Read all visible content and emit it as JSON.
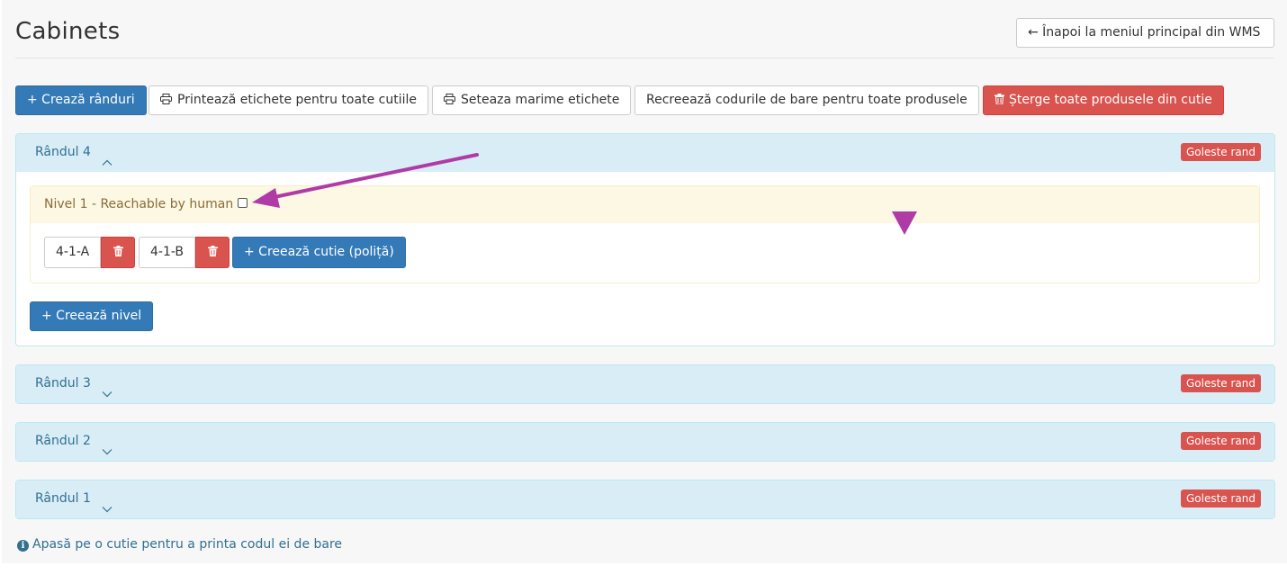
{
  "header": {
    "title": "Cabinets",
    "back_label": "← Înapoi la meniul principal din WMS"
  },
  "toolbar": {
    "create_rows": "+ Crează rânduri",
    "print_labels": "Printează etichete pentru toate cutiile",
    "set_label_size": "Seteaza marime etichete",
    "recreate_barcodes": "Recreează codurile de bare pentru toate produsele",
    "delete_all_products": "Șterge toate produsele din cutie"
  },
  "rows": [
    {
      "title": "Rândul 4",
      "expanded": true,
      "empty_label": "Goleste rand",
      "levels": [
        {
          "title": "Nivel 1 - Reachable by human",
          "boxes": [
            "4-1-A",
            "4-1-B"
          ],
          "create_box_label": "+ Creează cutie (poliță)"
        }
      ],
      "create_level_label": "+ Creează nivel"
    },
    {
      "title": "Rândul 3",
      "expanded": false,
      "empty_label": "Goleste rand"
    },
    {
      "title": "Rândul 2",
      "expanded": false,
      "empty_label": "Goleste rand"
    },
    {
      "title": "Rândul 1",
      "expanded": false,
      "empty_label": "Goleste rand"
    }
  ],
  "footer": {
    "info_icon": "info-icon",
    "info_text": "Apasă pe o cutie pentru a printa codul ei de bare"
  },
  "colors": {
    "primary": "#337ab7",
    "danger": "#d9534f",
    "info_heading": "#d9edf7",
    "warning_heading": "#fcf8e3",
    "annotation": "#b03aa6"
  }
}
